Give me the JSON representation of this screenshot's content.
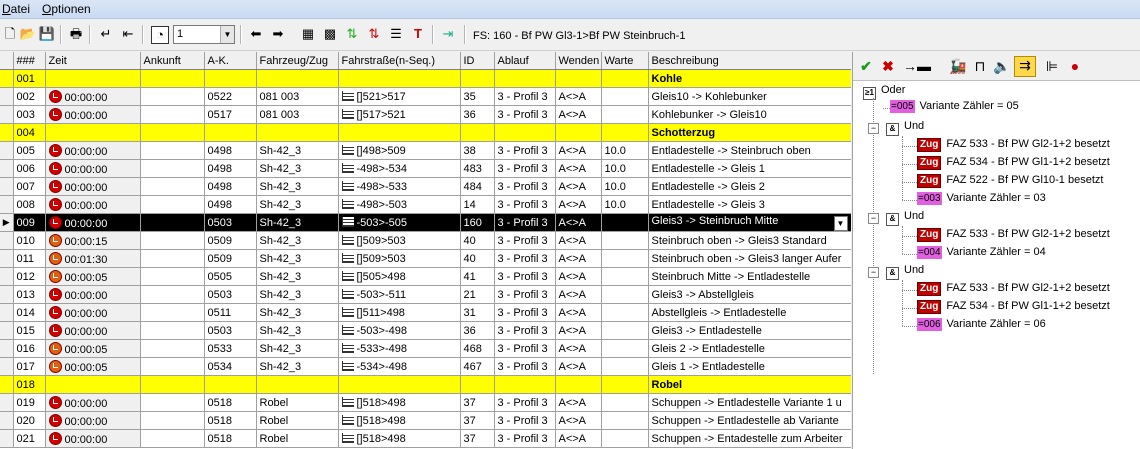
{
  "menu": {
    "items": [
      {
        "first": "D",
        "rest": "atei"
      },
      {
        "first": "O",
        "rest": "ptionen"
      }
    ]
  },
  "toolbar": {
    "combo_value": "1",
    "status_text": "FS: 160 - Bf PW Gl3-1>Bf PW Steinbruch-1"
  },
  "grid": {
    "headers": [
      "###",
      "Zeit",
      "Ankunft",
      "A-K.",
      "Fahrzeug/Zug",
      "Fahrstraße(n-Seq.)",
      "ID",
      "Ablauf",
      "Wenden",
      "Warte",
      "Beschreibung"
    ],
    "rows": [
      {
        "type": "group",
        "nr": "001",
        "title": "Kohle"
      },
      {
        "type": "row",
        "nr": "002",
        "zeit": "00:00:00",
        "clock": "red",
        "ankunft": "",
        "ak": "0522",
        "fzg": "081 003",
        "fs": "[]521>517",
        "id": "35",
        "ablauf": "3 - Profil 3",
        "wenden": "A<>A",
        "warte": "",
        "beschr": "Gleis10 -> Kohlebunker"
      },
      {
        "type": "row",
        "nr": "003",
        "zeit": "00:00:00",
        "clock": "red",
        "ankunft": "",
        "ak": "0517",
        "fzg": "081 003",
        "fs": "[]517>521",
        "id": "36",
        "ablauf": "3 - Profil 3",
        "wenden": "A<>A",
        "warte": "",
        "beschr": "Kohlebunker -> Gleis10"
      },
      {
        "type": "group",
        "nr": "004",
        "title": "Schotterzug"
      },
      {
        "type": "row",
        "nr": "005",
        "zeit": "00:00:00",
        "clock": "red",
        "ankunft": "",
        "ak": "0498",
        "fzg": "Sh-42_3",
        "fs": "[]498>509",
        "id": "38",
        "ablauf": "3 - Profil 3",
        "wenden": "A<>A",
        "warte": "10.0",
        "beschr": "Entladestelle -> Steinbruch oben"
      },
      {
        "type": "row",
        "nr": "006",
        "zeit": "00:00:00",
        "clock": "red",
        "ankunft": "",
        "ak": "0498",
        "fzg": "Sh-42_3",
        "fs": "-498>-534",
        "id": "483",
        "ablauf": "3 - Profil 3",
        "wenden": "A<>A",
        "warte": "10.0",
        "beschr": "Entladestelle -> Gleis 1"
      },
      {
        "type": "row",
        "nr": "007",
        "zeit": "00:00:00",
        "clock": "red",
        "ankunft": "",
        "ak": "0498",
        "fzg": "Sh-42_3",
        "fs": "-498>-533",
        "id": "484",
        "ablauf": "3 - Profil 3",
        "wenden": "A<>A",
        "warte": "10.0",
        "beschr": "Entladestelle -> Gleis 2"
      },
      {
        "type": "row",
        "nr": "008",
        "zeit": "00:00:00",
        "clock": "red",
        "ankunft": "",
        "ak": "0498",
        "fzg": "Sh-42_3",
        "fs": "-498>-503",
        "id": "14",
        "ablauf": "3 - Profil 3",
        "wenden": "A<>A",
        "warte": "10.0",
        "beschr": "Entladestelle -> Gleis 3"
      },
      {
        "type": "selected",
        "nr": "009",
        "zeit": "00:00:00",
        "clock": "red",
        "ankunft": "",
        "ak": "0503",
        "fzg": "Sh-42_3",
        "fs": "-503>-505",
        "id": "160",
        "ablauf": "3 - Profil 3",
        "wenden": "A<>A",
        "warte": "",
        "beschr": "Gleis3 -> Steinbruch Mitte"
      },
      {
        "type": "row",
        "nr": "010",
        "zeit": "00:00:15",
        "clock": "ora",
        "ankunft": "",
        "ak": "0509",
        "fzg": "Sh-42_3",
        "fs": "[]509>503",
        "id": "40",
        "ablauf": "3 - Profil 3",
        "wenden": "A<>A",
        "warte": "",
        "beschr": "Steinbruch oben -> Gleis3 Standard"
      },
      {
        "type": "row",
        "nr": "011",
        "zeit": "00:01:30",
        "clock": "ora",
        "ankunft": "",
        "ak": "0509",
        "fzg": "Sh-42_3",
        "fs": "[]509>503",
        "id": "40",
        "ablauf": "3 - Profil 3",
        "wenden": "A<>A",
        "warte": "",
        "beschr": "Steinbruch oben -> Gleis3 langer Aufer"
      },
      {
        "type": "row",
        "nr": "012",
        "zeit": "00:00:05",
        "clock": "ora",
        "ankunft": "",
        "ak": "0505",
        "fzg": "Sh-42_3",
        "fs": "[]505>498",
        "id": "41",
        "ablauf": "3 - Profil 3",
        "wenden": "A<>A",
        "warte": "",
        "beschr": "Steinbruch Mitte -> Entladestelle"
      },
      {
        "type": "row",
        "nr": "013",
        "zeit": "00:00:00",
        "clock": "red",
        "ankunft": "",
        "ak": "0503",
        "fzg": "Sh-42_3",
        "fs": "-503>-511",
        "id": "21",
        "ablauf": "3 - Profil 3",
        "wenden": "A<>A",
        "warte": "",
        "beschr": "Gleis3 -> Abstellgleis"
      },
      {
        "type": "row",
        "nr": "014",
        "zeit": "00:00:00",
        "clock": "red",
        "ankunft": "",
        "ak": "0511",
        "fzg": "Sh-42_3",
        "fs": "[]511>498",
        "id": "31",
        "ablauf": "3 - Profil 3",
        "wenden": "A<>A",
        "warte": "",
        "beschr": "Abstellgleis -> Entladestelle"
      },
      {
        "type": "row",
        "nr": "015",
        "zeit": "00:00:00",
        "clock": "red",
        "ankunft": "",
        "ak": "0503",
        "fzg": "Sh-42_3",
        "fs": "-503>-498",
        "id": "36",
        "ablauf": "3 - Profil 3",
        "wenden": "A<>A",
        "warte": "",
        "beschr": "Gleis3 -> Entladestelle"
      },
      {
        "type": "row",
        "nr": "016",
        "zeit": "00:00:05",
        "clock": "ora",
        "ankunft": "",
        "ak": "0533",
        "fzg": "Sh-42_3",
        "fs": "-533>-498",
        "id": "468",
        "ablauf": "3 - Profil 3",
        "wenden": "A<>A",
        "warte": "",
        "beschr": "Gleis 2 -> Entladestelle"
      },
      {
        "type": "row",
        "nr": "017",
        "zeit": "00:00:05",
        "clock": "ora",
        "ankunft": "",
        "ak": "0534",
        "fzg": "Sh-42_3",
        "fs": "-534>-498",
        "id": "467",
        "ablauf": "3 - Profil 3",
        "wenden": "A<>A",
        "warte": "",
        "beschr": "Gleis 1 -> Entladestelle"
      },
      {
        "type": "group",
        "nr": "018",
        "title": "Robel"
      },
      {
        "type": "row",
        "nr": "019",
        "zeit": "00:00:00",
        "clock": "red",
        "ankunft": "",
        "ak": "0518",
        "fzg": "Robel",
        "fs": "[]518>498",
        "id": "37",
        "ablauf": "3 - Profil 3",
        "wenden": "A<>A",
        "warte": "",
        "beschr": "Schuppen -> Entladestelle Variante 1 u"
      },
      {
        "type": "row",
        "nr": "020",
        "zeit": "00:00:00",
        "clock": "red",
        "ankunft": "",
        "ak": "0518",
        "fzg": "Robel",
        "fs": "[]518>498",
        "id": "37",
        "ablauf": "3 - Profil 3",
        "wenden": "A<>A",
        "warte": "",
        "beschr": "Schuppen -> Entladestelle ab Variante"
      },
      {
        "type": "row",
        "nr": "021",
        "zeit": "00:00:00",
        "clock": "red",
        "ankunft": "",
        "ak": "0518",
        "fzg": "Robel",
        "fs": "[]518>498",
        "id": "37",
        "ablauf": "3 - Profil 3",
        "wenden": "A<>A",
        "warte": "",
        "beschr": "Schuppen -> Entadestelle zum Arbeiter"
      }
    ]
  },
  "tree": {
    "root_label": "Oder",
    "root_counter": {
      "badge": "=005",
      "label": "Variante Zähler = 05"
    },
    "groups": [
      {
        "label": "Und",
        "items": [
          {
            "kind": "zug",
            "badge": "Zug",
            "label": "FAZ 533 - Bf PW Gl2-1+2 besetzt"
          },
          {
            "kind": "zug",
            "badge": "Zug",
            "label": "FAZ 534 - Bf PW Gl1-1+2 besetzt"
          },
          {
            "kind": "zug",
            "badge": "Zug",
            "label": "FAZ 522 - Bf PW Gl10-1 besetzt"
          },
          {
            "kind": "ctr",
            "badge": "=003",
            "label": "Variante Zähler = 03"
          }
        ]
      },
      {
        "label": "Und",
        "items": [
          {
            "kind": "zug",
            "badge": "Zug",
            "label": "FAZ 533 - Bf PW Gl2-1+2 besetzt"
          },
          {
            "kind": "ctr",
            "badge": "=004",
            "label": "Variante Zähler = 04"
          }
        ]
      },
      {
        "label": "Und",
        "items": [
          {
            "kind": "zug",
            "badge": "Zug",
            "label": "FAZ 533 - Bf PW Gl2-1+2 besetzt"
          },
          {
            "kind": "zug",
            "badge": "Zug",
            "label": "FAZ 534 - Bf PW Gl1-1+2 besetzt"
          },
          {
            "kind": "ctr",
            "badge": "=006",
            "label": "Variante Zähler = 06"
          }
        ]
      }
    ]
  },
  "colors": {
    "group_row": "#ffff00",
    "selected_row": "#000000",
    "clock_red": "#d00000",
    "zug_badge": "#c00000",
    "counter_badge": "#e060e0"
  }
}
